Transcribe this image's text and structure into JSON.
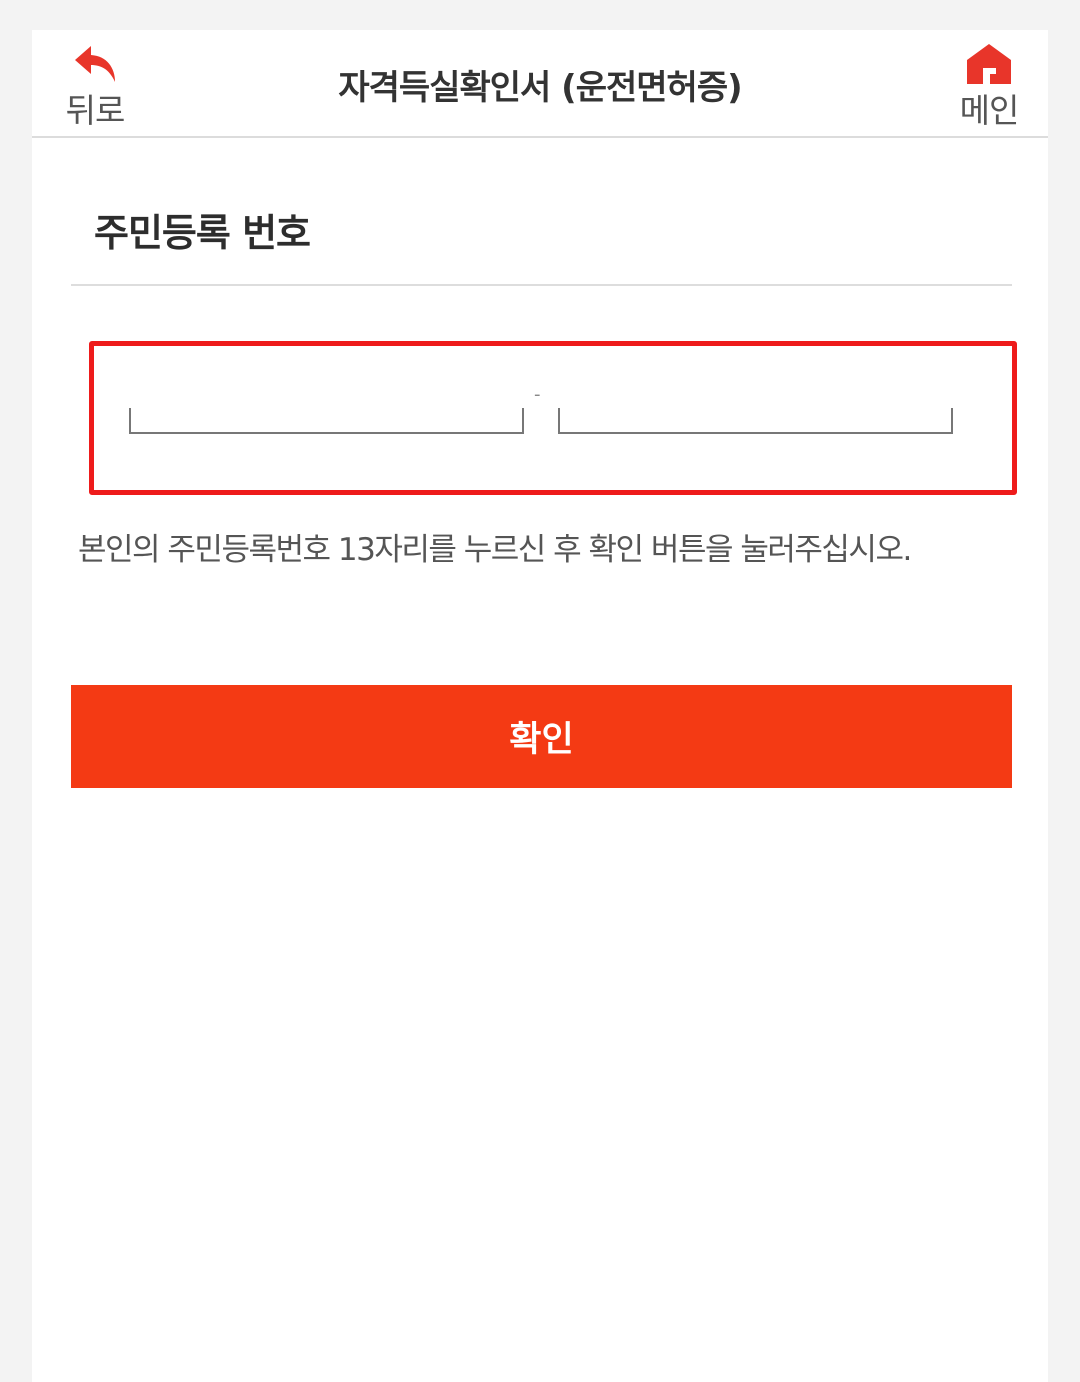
{
  "header": {
    "back_label": "뒤로",
    "title": "자격득실확인서 (운전면허증)",
    "home_label": "메인"
  },
  "form": {
    "section_title": "주민등록 번호",
    "rrn_front_value": "",
    "rrn_back_value": "",
    "separator": "-",
    "instruction": "본인의 주민등록번호 13자리를 누르신 후 확인 버튼을 눌러주십시오.",
    "confirm_label": "확인"
  },
  "colors": {
    "accent": "#f43a14",
    "highlight_border": "#ee1b1b",
    "icon_red": "#e8352a"
  },
  "icons": {
    "back": "back-arrow-icon",
    "home": "home-icon"
  }
}
